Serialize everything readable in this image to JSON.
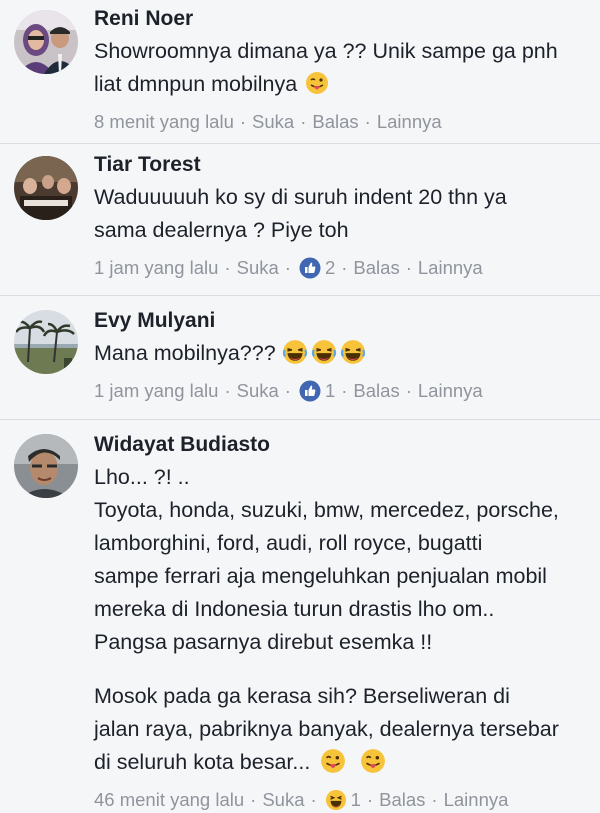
{
  "comments": [
    {
      "name": "Reni Noer",
      "text_lines": [
        "Showroomnya dimana ya ?? Unik sampe ga pnh",
        "liat dmnpun mobilnya"
      ],
      "time": "8 menit yang lalu",
      "like": "Suka",
      "reply": "Balas",
      "more": "Lainnya"
    },
    {
      "name": "Tiar Torest",
      "text_lines": [
        "Waduuuuuh ko sy di suruh indent 20 thn ya",
        "sama dealernya ? Piye toh"
      ],
      "time": "1 jam yang lalu",
      "like": "Suka",
      "reaction_count": "2",
      "reply": "Balas",
      "more": "Lainnya"
    },
    {
      "name": "Evy Mulyani",
      "text_lines": [
        "Mana mobilnya???"
      ],
      "time": "1 jam yang lalu",
      "like": "Suka",
      "reaction_count": "1",
      "reply": "Balas",
      "more": "Lainnya"
    },
    {
      "name": "Widayat Budiasto",
      "text_lines": [
        "Lho... ?! ..",
        "Toyota, honda, suzuki, bmw, mercedez, porsche,",
        "lamborghini, ford, audi, roll royce, bugatti",
        "sampe ferrari aja mengeluhkan penjualan mobil",
        "mereka di Indonesia turun drastis lho om..",
        "Pangsa pasarnya direbut esemka !!",
        "Mosok pada ga kerasa sih? Berseliweran di",
        "jalan raya, pabriknya banyak, dealernya tersebar",
        "di seluruh kota besar..."
      ],
      "time": "46 menit yang lalu",
      "like": "Suka",
      "reaction_count": "1",
      "reply": "Balas",
      "more": "Lainnya"
    }
  ],
  "colors": {
    "like_blue": "#4267b2",
    "meta_gray": "#90949c",
    "emoji_yellow": "#f7c33b"
  },
  "icons": [
    "tongue-out-emoji-icon",
    "laughing-emoji-icon",
    "like-reaction-icon",
    "haha-reaction-icon"
  ]
}
